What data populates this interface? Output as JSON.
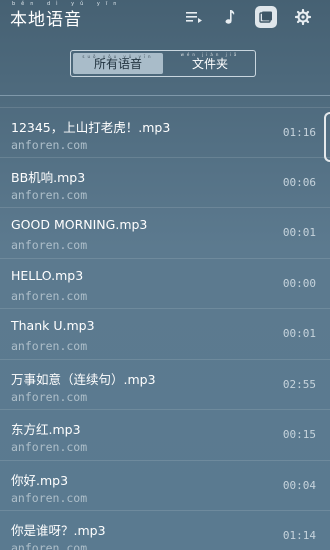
{
  "header": {
    "title": "本地语音",
    "title_pinyin": "běn dì yǔ yīn",
    "icons": [
      "playlist-icon",
      "music-note-icon",
      "folder-icon",
      "gear-icon"
    ]
  },
  "tabs": [
    {
      "label": "所有语音",
      "pinyin": "suǒ yǒu yǔ yīn",
      "selected": true
    },
    {
      "label": "文件夹",
      "pinyin": "wén jiàn jiā",
      "selected": false
    }
  ],
  "songs": [
    {
      "title": "12345，上山打老虎！.mp3",
      "source": "anforen.com",
      "duration": "01:16"
    },
    {
      "title": "BB机响.mp3",
      "source": "anforen.com",
      "duration": "00:06"
    },
    {
      "title": "GOOD MORNING.mp3",
      "source": "anforen.com",
      "duration": "00:01"
    },
    {
      "title": "HELLO.mp3",
      "source": "anforen.com",
      "duration": "00:00"
    },
    {
      "title": "Thank U.mp3",
      "source": "anforen.com",
      "duration": "00:01"
    },
    {
      "title": "万事如意（连续句）.mp3",
      "source": "anforen.com",
      "duration": "02:55"
    },
    {
      "title": "东方红.mp3",
      "source": "anforen.com",
      "duration": "00:15"
    },
    {
      "title": "你好.mp3",
      "source": "anforen.com",
      "duration": "00:04"
    },
    {
      "title": "你是谁呀？.mp3",
      "source": "anforen.com",
      "duration": "01:14"
    }
  ],
  "colors": {
    "accent": "#dfe6eb",
    "background": "#5c7a8f"
  }
}
